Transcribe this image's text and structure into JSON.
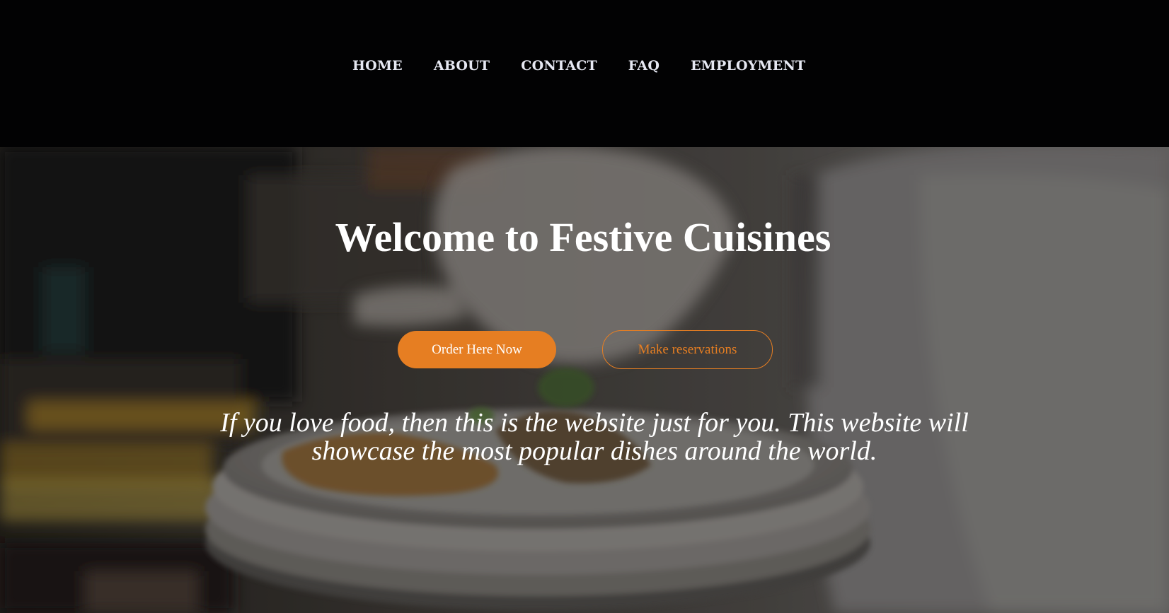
{
  "nav": {
    "items": [
      {
        "label": "HOME"
      },
      {
        "label": "ABOUT"
      },
      {
        "label": "CONTACT"
      },
      {
        "label": "FAQ"
      },
      {
        "label": "EMPLOYMENT"
      }
    ]
  },
  "hero": {
    "title": "Welcome to Festive Cuisines",
    "order_button": "Order Here Now",
    "reserve_button": "Make reservations",
    "tagline": "If you love food, then this is the website just for you. This website will showcase the most popular dishes around the world."
  },
  "colors": {
    "accent": "#e67e22",
    "nav_background": "#020203",
    "text_light": "#ffffff"
  }
}
